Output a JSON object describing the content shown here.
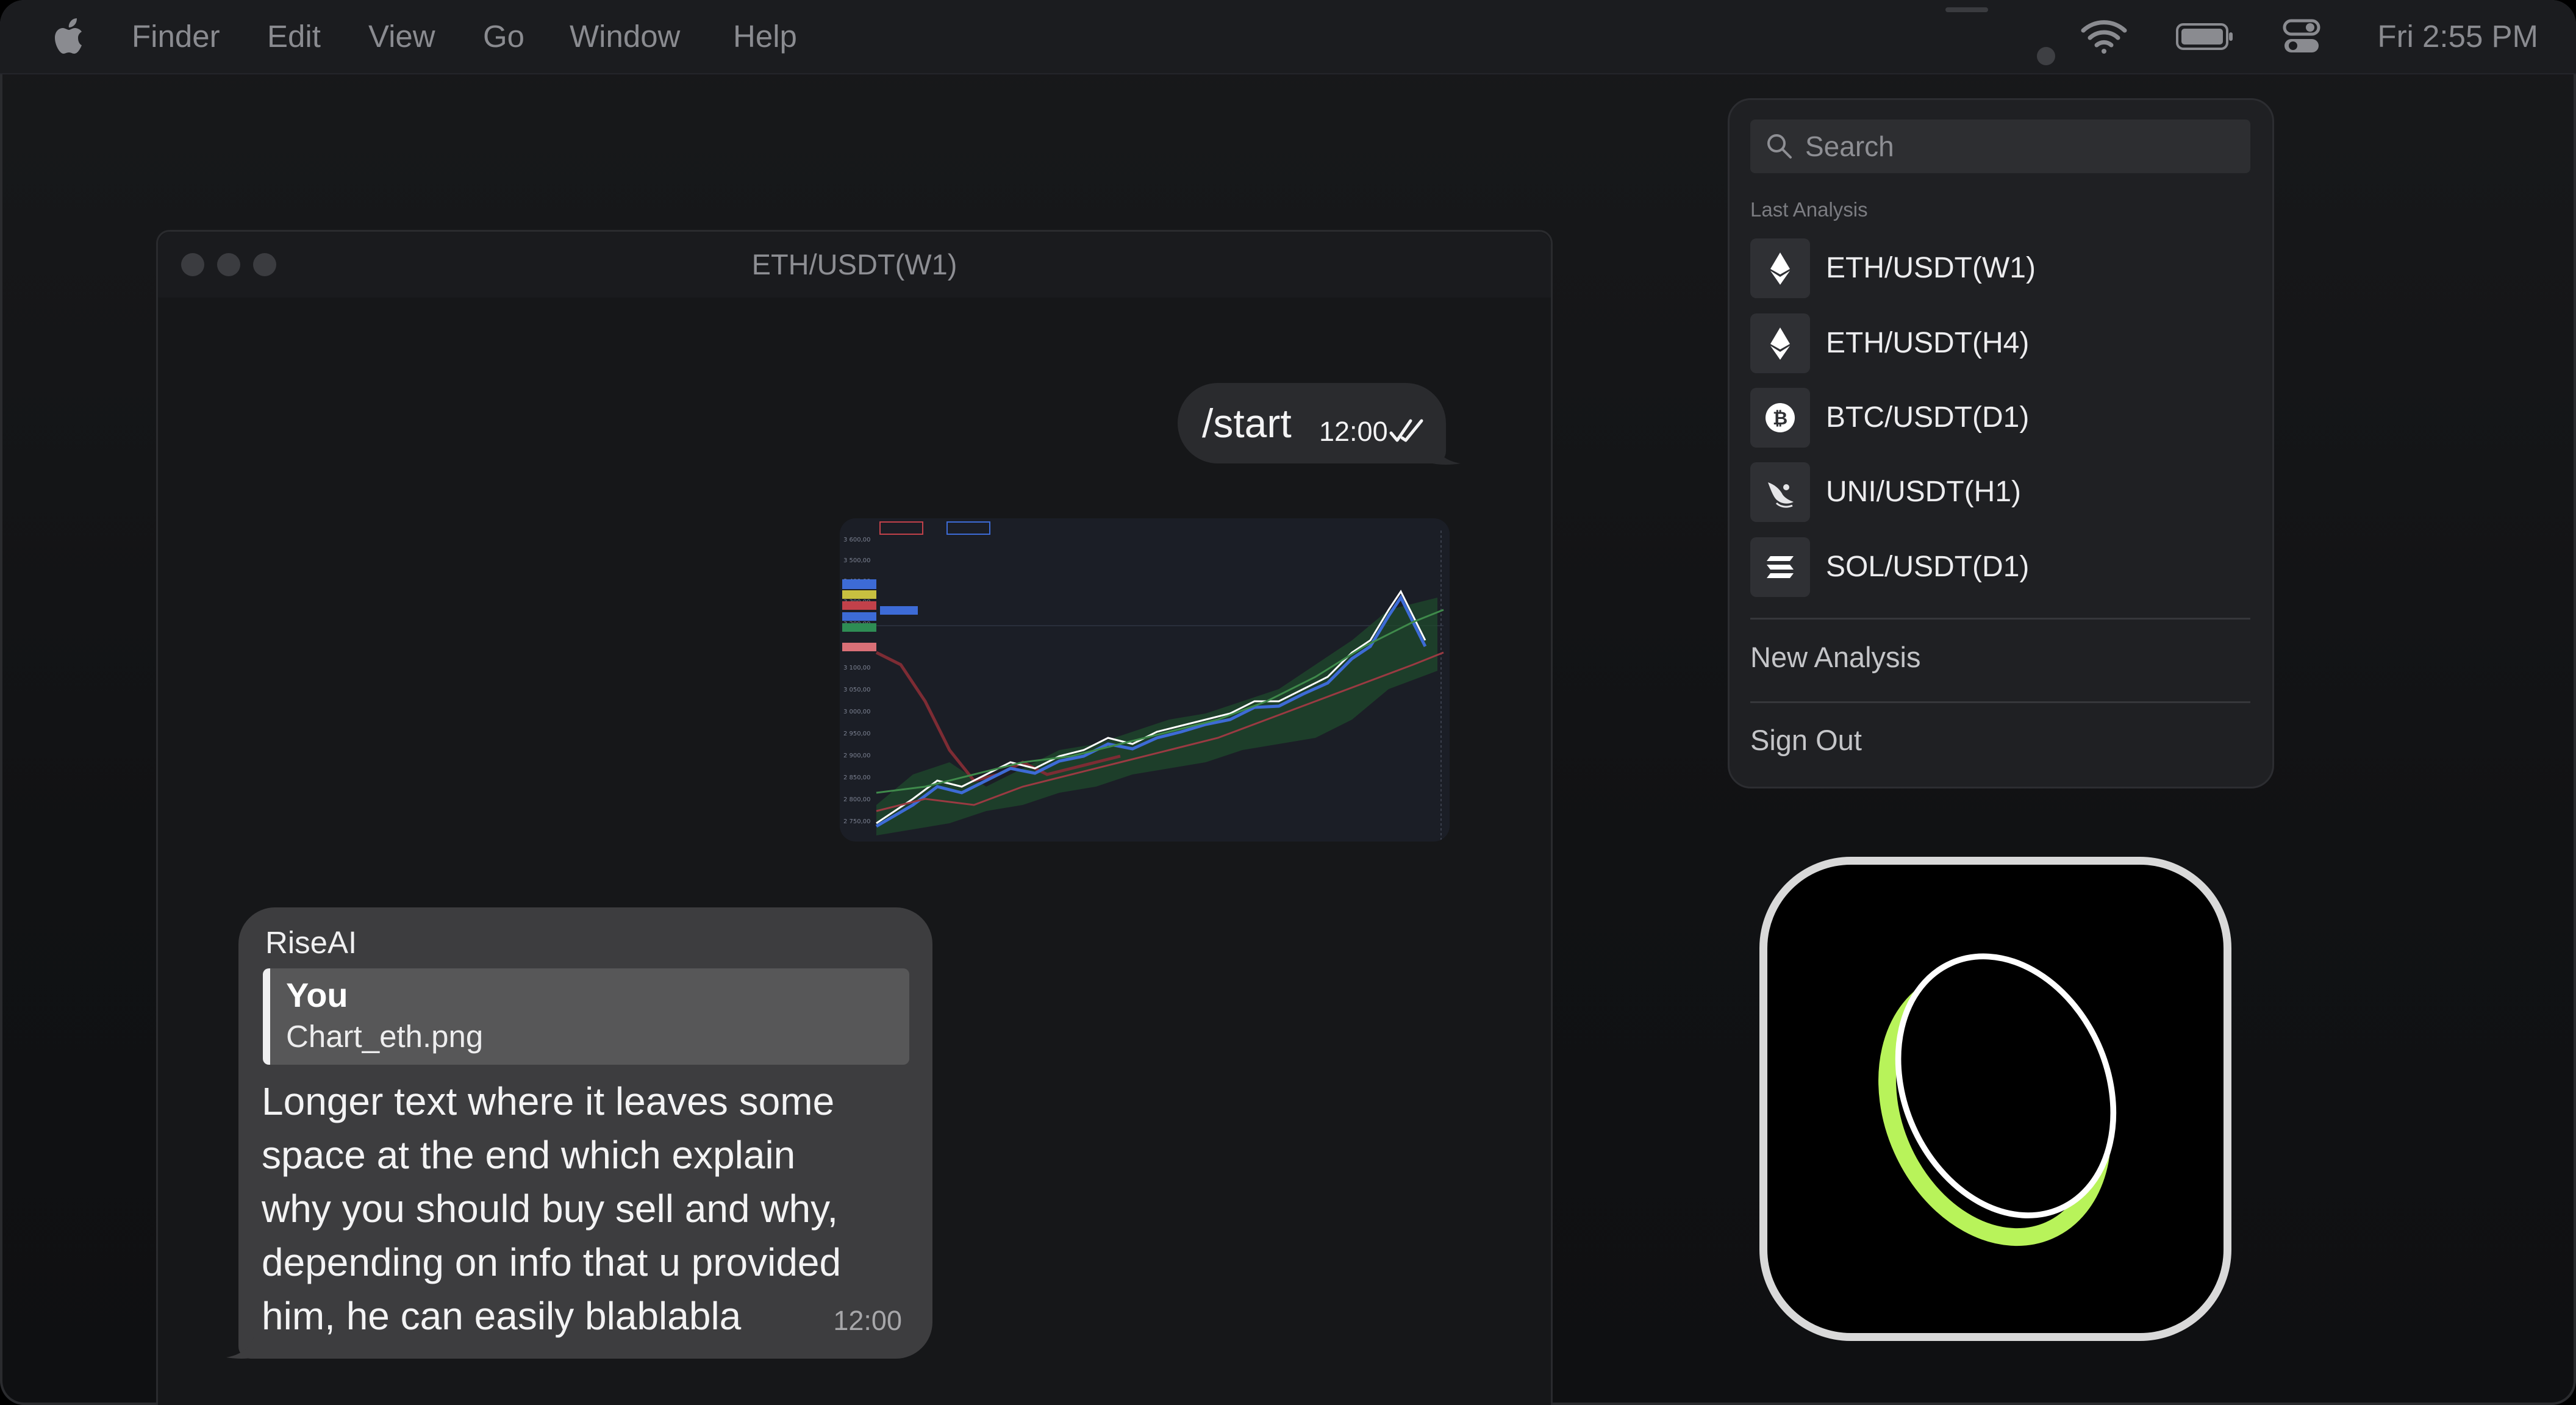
{
  "menubar": {
    "items": [
      "Finder",
      "Edit",
      "View",
      "Go",
      "Window",
      "Help"
    ],
    "clock": "Fri 2:55 PM"
  },
  "chat": {
    "window_title": "ETH/USDT(W1)",
    "outgoing": {
      "text": "/start",
      "time": "12:00"
    },
    "attachment": {
      "icon": "candlestick-chart-image"
    },
    "incoming": {
      "sender": "RiseAI",
      "quote_author": "You",
      "quote_file": "Chart_eth.png",
      "text": "Longer text where it leaves some\nspace at the end which explain\nwhy you should buy sell and why,\ndepending on info that u provided\nhim, he can easily blablabla",
      "time": "12:00"
    }
  },
  "panel": {
    "search_placeholder": "Search",
    "section_label": "Last Analysis",
    "pairs": [
      {
        "label": "ETH/USDT(W1)",
        "icon": "ethereum-icon"
      },
      {
        "label": "ETH/USDT(H4)",
        "icon": "ethereum-icon"
      },
      {
        "label": "BTC/USDT(D1)",
        "icon": "bitcoin-icon"
      },
      {
        "label": "UNI/USDT(H1)",
        "icon": "uniswap-icon"
      },
      {
        "label": "SOL/USDT(D1)",
        "icon": "solana-icon"
      }
    ],
    "new_analysis": "New Analysis",
    "sign_out": "Sign Out"
  },
  "colors": {
    "accent": "#b8f35a",
    "background": "#131416",
    "bubble_in": "#3d3d3f",
    "bubble_out": "#2a2b2e"
  }
}
